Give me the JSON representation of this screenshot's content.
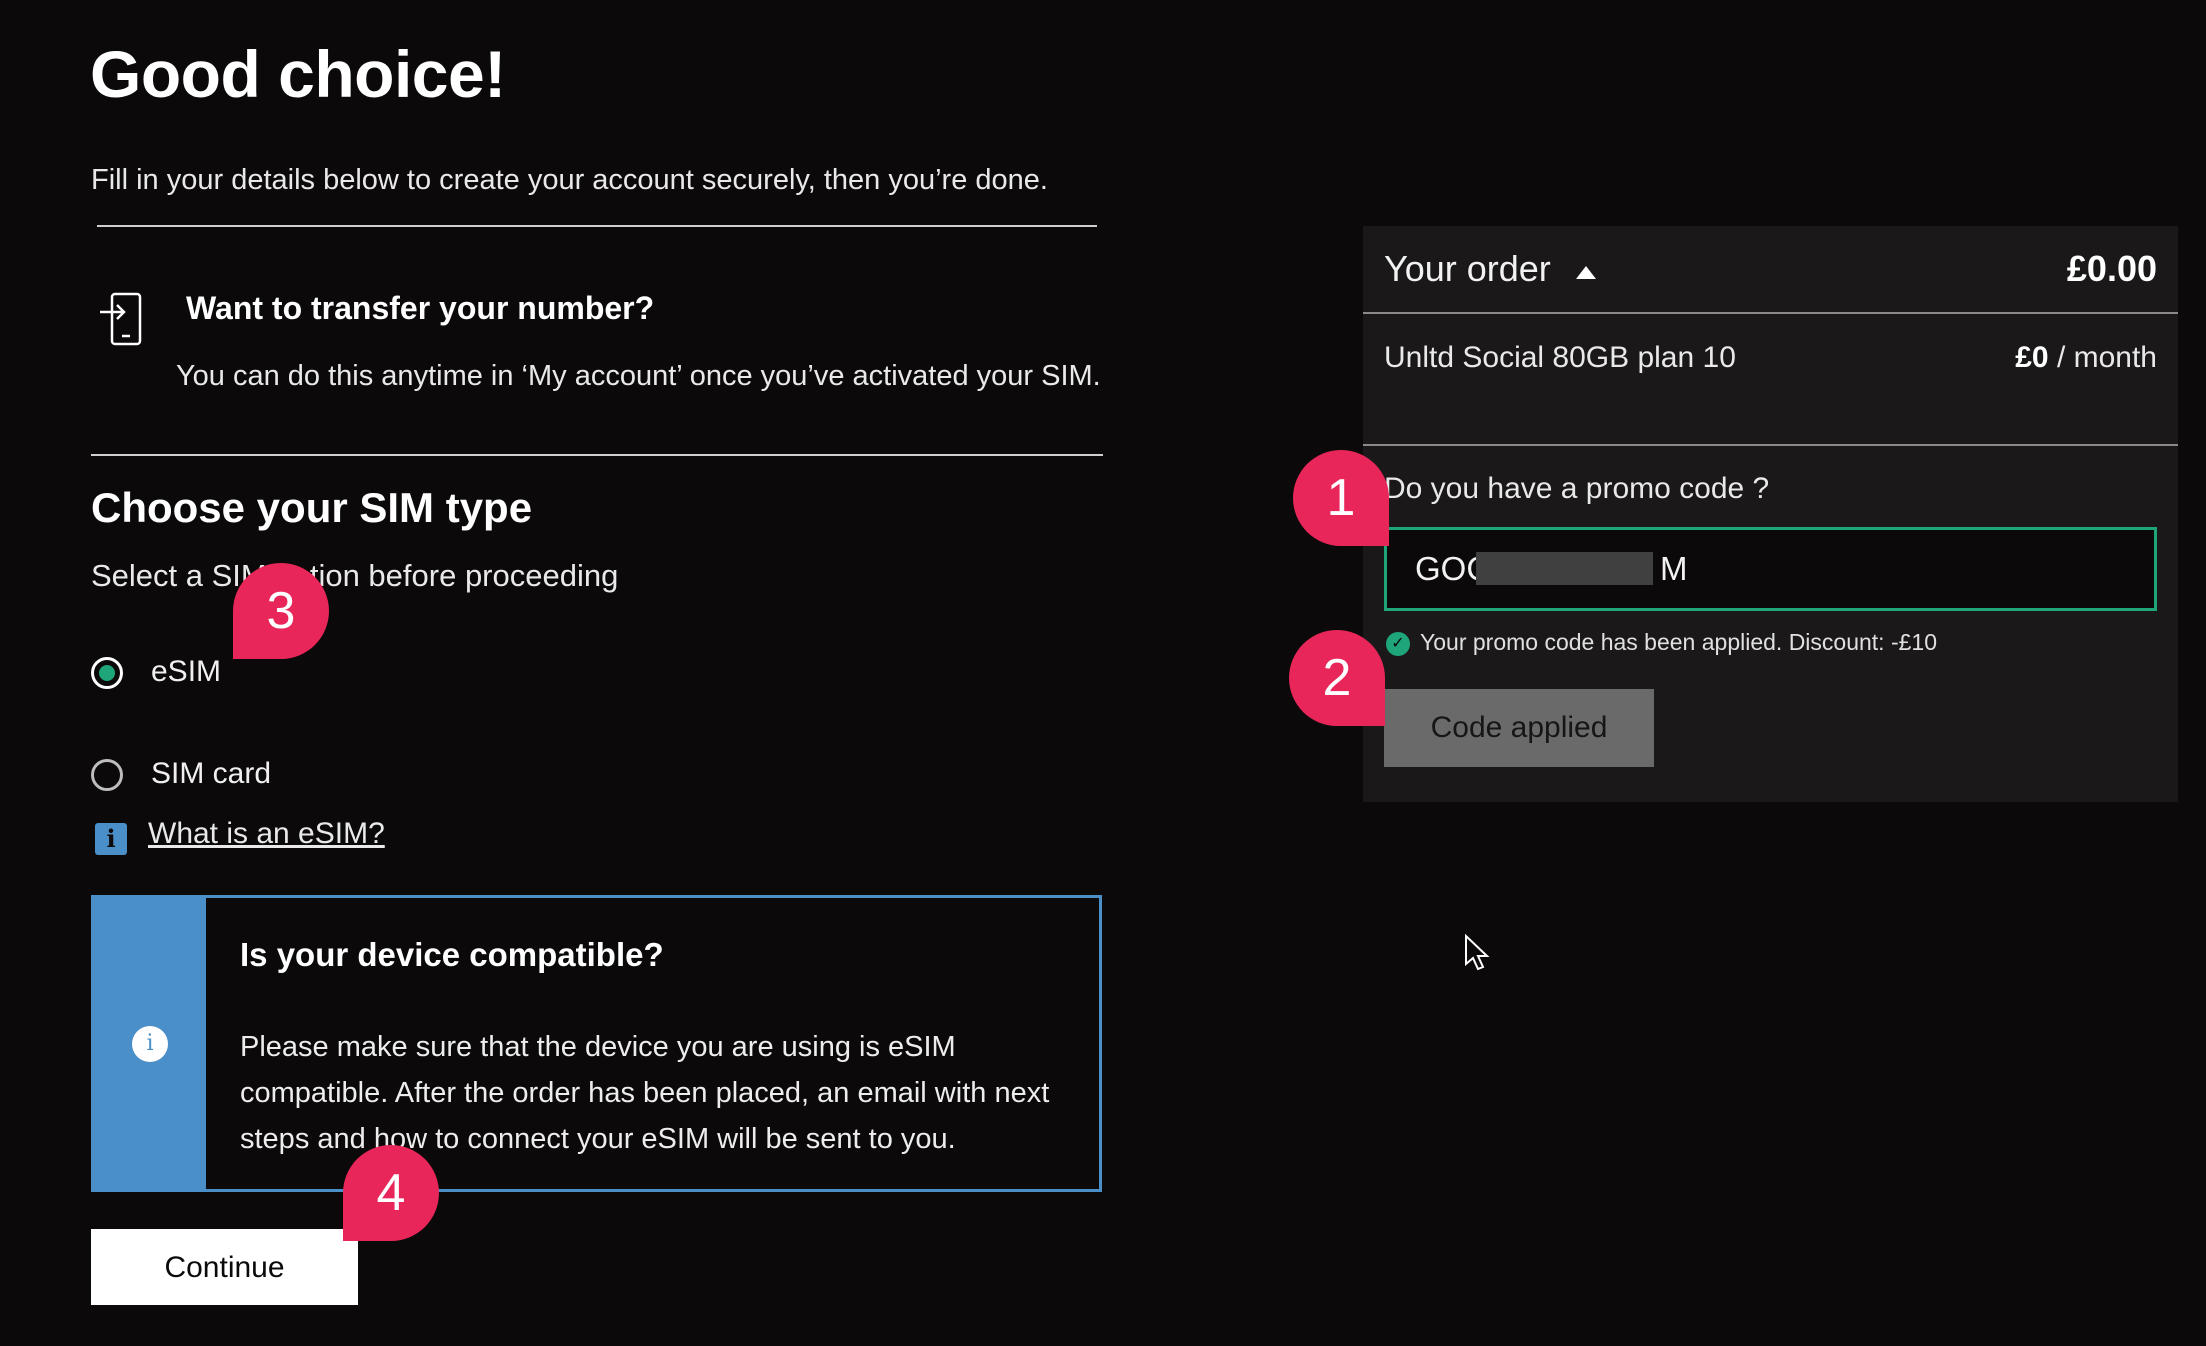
{
  "header": {
    "title": "Good choice!",
    "subtitle": "Fill in your details below to create your account securely, then you’re done."
  },
  "transfer": {
    "icon": "phone-transfer-icon",
    "heading": "Want to transfer your number?",
    "text": "You can do this anytime in ‘My account’ once you’ve activated your SIM."
  },
  "sim": {
    "heading": "Choose your SIM type",
    "subtitle": "Select a SIM option before proceeding",
    "options": [
      {
        "label": "eSIM",
        "selected": true
      },
      {
        "label": "SIM card",
        "selected": false
      }
    ],
    "info_link": "What is an eSIM?"
  },
  "compat": {
    "heading": "Is your device compatible?",
    "text": "Please make sure that the device you are using is eSIM compatible. After the order has been placed, an email with next steps and how to connect your eSIM will be sent to you."
  },
  "continue_label": "Continue",
  "order": {
    "title": "Your order",
    "total": "£0.00",
    "plan_name": "Unltd Social 80GB plan 10",
    "plan_price_amount": "£0",
    "plan_price_period": " / month",
    "promo_label": "Do you have a promo code ?",
    "promo_value_start": "GOC",
    "promo_value_end": "M",
    "promo_success": "Your promo code has been applied. Discount: -£10",
    "code_button": "Code applied"
  },
  "markers": [
    "1",
    "2",
    "3",
    "4"
  ],
  "colors": {
    "background": "#0b0909",
    "accent_green": "#1fa57a",
    "info_blue": "#4a8fc7",
    "marker_pink": "#e8265a",
    "panel": "#1a1818"
  }
}
